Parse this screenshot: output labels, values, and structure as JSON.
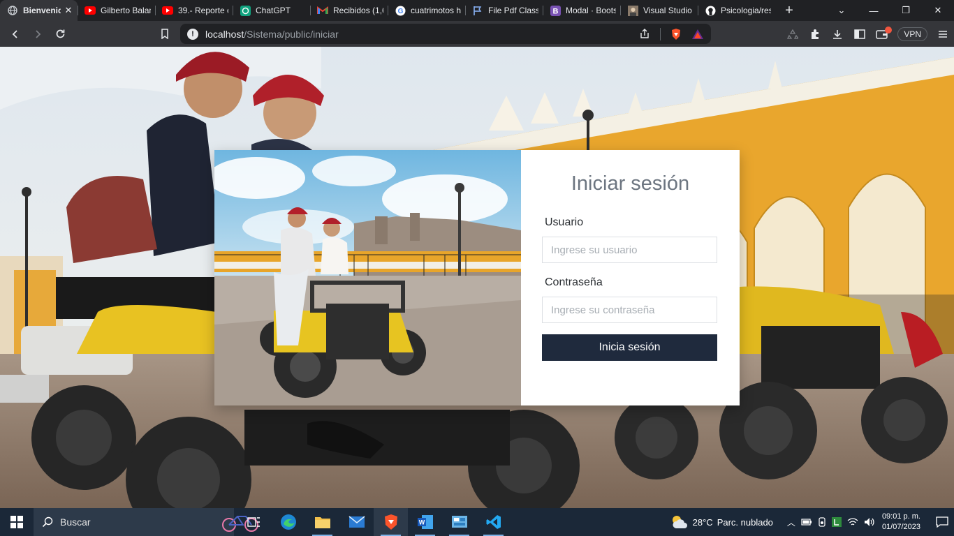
{
  "browser": {
    "tabs": [
      {
        "title": "Bienvenid",
        "icon": "globe-icon",
        "active": true
      },
      {
        "title": "Gilberto Balam",
        "icon": "youtube-icon"
      },
      {
        "title": "39.- Reporte c",
        "icon": "youtube-icon"
      },
      {
        "title": "ChatGPT",
        "icon": "chatgpt-icon"
      },
      {
        "title": "Recibidos (1,6",
        "icon": "gmail-icon"
      },
      {
        "title": "cuatrimotos h",
        "icon": "google-icon"
      },
      {
        "title": "File Pdf Classi",
        "icon": "flag-icon"
      },
      {
        "title": "Modal · Boots",
        "icon": "bootstrap-icon"
      },
      {
        "title": "Visual Studio",
        "icon": "avatar-icon"
      },
      {
        "title": "Psicologia/res",
        "icon": "github-icon"
      }
    ],
    "new_tab": "+",
    "url_host": "localhost",
    "url_path": "/Sistema/public/iniciar",
    "vpn_label": "VPN"
  },
  "login": {
    "title": "Iniciar sesión",
    "user_label": "Usuario",
    "user_placeholder": "Ingrese su usuario",
    "password_label": "Contraseña",
    "password_placeholder": "Ingrese su contraseña",
    "submit_label": "Inicia sesión"
  },
  "taskbar": {
    "search_label": "Buscar",
    "temperature": "28°C",
    "weather": "Parc. nublado",
    "time": "09:01 p. m.",
    "date": "01/07/2023"
  },
  "colors": {
    "button_bg": "#1f2a3d",
    "title_color": "#6c7580",
    "browser_dark": "#202124",
    "toolbar": "#35363a",
    "taskbar": "#1b2838"
  }
}
